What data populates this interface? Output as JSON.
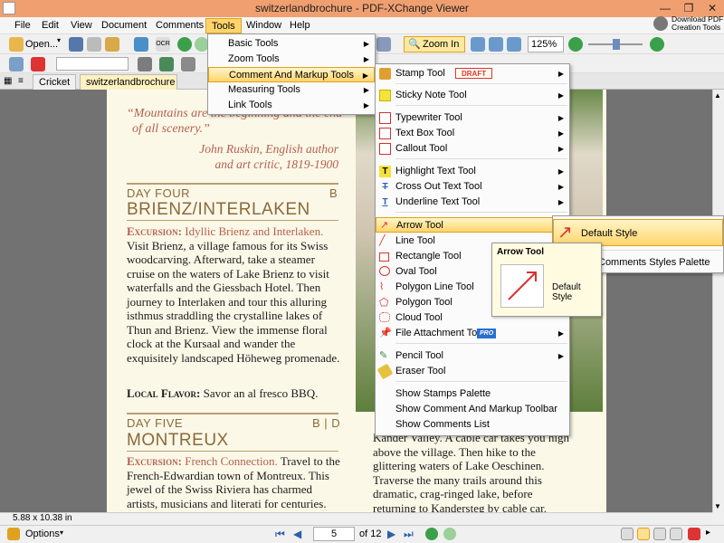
{
  "window": {
    "title": "switzerlandbrochure - PDF-XChange Viewer",
    "min": "—",
    "max": "❐",
    "close": "✕"
  },
  "menubar": [
    "File",
    "Edit",
    "View",
    "Document",
    "Comments",
    "Tools",
    "Window",
    "Help"
  ],
  "download_promo": "Download PDF Creation Tools",
  "toolbar": {
    "open_label": "Open...",
    "zoom_in_label": "Zoom In",
    "zoom_value": "125%"
  },
  "tabs": [
    "Cricket",
    "switzerlandbrochure"
  ],
  "tools_menu": [
    {
      "label": "Basic Tools"
    },
    {
      "label": "Zoom Tools"
    },
    {
      "label": "Comment And Markup Tools"
    },
    {
      "label": "Measuring Tools"
    },
    {
      "label": "Link Tools"
    }
  ],
  "markup_menu": {
    "stamp_label": "Stamp Tool",
    "stamp_badge": "DRAFT",
    "items": [
      "Sticky Note Tool",
      "Typewriter Tool",
      "Text Box Tool",
      "Callout Tool",
      "Highlight Text Tool",
      "Cross Out Text Tool",
      "Underline Text Tool",
      "Arrow Tool",
      "Line Tool",
      "Rectangle Tool",
      "Oval Tool",
      "Polygon Line Tool",
      "Polygon Tool",
      "Cloud Tool",
      "File Attachment Tool",
      "Pencil Tool",
      "Eraser Tool",
      "Show Stamps Palette",
      "Show Comment And Markup Toolbar",
      "Show Comments List"
    ],
    "pro_badge": "PRO"
  },
  "arrow_submenu": {
    "default_style": "Default Style",
    "palette": "Comments Styles Palette"
  },
  "tooltip": {
    "title": "Arrow Tool",
    "style": "Default Style"
  },
  "document": {
    "quote": "“Mountains are the beginning and the end of all scenery.”",
    "quote_line1": "“Mountains are the beginning and the end",
    "quote_line2": "of all scenery.”",
    "attribution1": "John Ruskin, English author",
    "attribution2": "and art critic, 1819-1900",
    "day4": "DAY FOUR",
    "day4_code": "B",
    "city4": "BRIENZ/INTERLAKEN",
    "excursion_label": "Excursion:",
    "excursion4": "Idyllic Brienz and Interlaken.",
    "body4": "Visit Brienz, a village famous for its Swiss woodcarving. Afterward, take a steamer cruise on the waters of Lake Brienz to visit waterfalls and the Giessbach Hotel. Then journey to Interlaken and tour this alluring isthmus straddling the crystalline lakes of Thun and Brienz. View the immense floral clock at the Kursaal and wander the exquisitely landscaped Höheweg promenade.",
    "flavor_label": "Local Flavor:",
    "flavor": "Savor an al fresco BBQ.",
    "day5": "DAY FIVE",
    "day5_code": "B | D",
    "city5": "MONTREUX",
    "excursion5": "French Connection.",
    "body5a": "Travel to",
    "body5": "the French-Edwardian town of Montreux. This jewel of the Swiss Riviera has charmed artists, musicians and literati for centuries.",
    "right_col": "Kander Valley. A cable car takes you high above the village. Then hike to the glittering waters of Lake Oeschinen. Traverse the many trails around this dramatic, crag-ringed lake, before returning to Kandersteg by cable car."
  },
  "status": {
    "page_size": "5.88 x 10.38 in",
    "options": "Options",
    "current_page": "5",
    "of_pages": "of 12"
  }
}
